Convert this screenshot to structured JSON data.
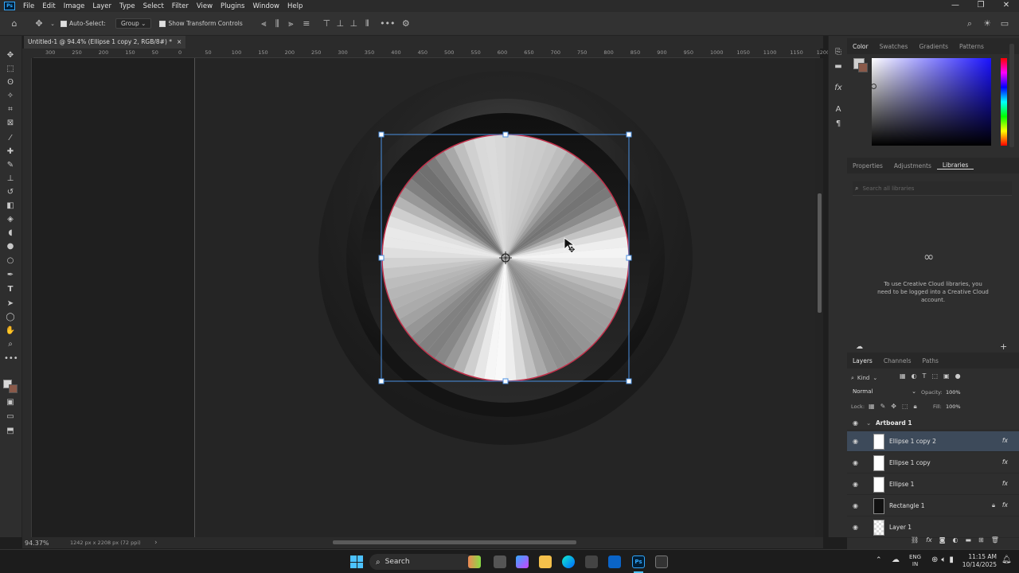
{
  "app": {
    "menus": [
      "File",
      "Edit",
      "Image",
      "Layer",
      "Type",
      "Select",
      "Filter",
      "View",
      "Plugins",
      "Window",
      "Help"
    ],
    "window_controls": [
      "—",
      "❐",
      "✕"
    ]
  },
  "options": {
    "auto_select_label": "Auto-Select:",
    "auto_select_value": "Group",
    "transform_label": "Show Transform Controls"
  },
  "document": {
    "tab_title": "Untitled-1 @ 94.4% (Ellipse 1 copy 2, RGB/8#) *",
    "close": "×"
  },
  "ruler": {
    "labels": [
      "300",
      "250",
      "200",
      "150",
      "50",
      "0",
      "50",
      "100",
      "150",
      "200",
      "250",
      "300",
      "350",
      "400",
      "450",
      "500",
      "550",
      "600",
      "650",
      "700",
      "750",
      "800",
      "850",
      "900",
      "950",
      "1000",
      "1050",
      "1100",
      "1150",
      "1200"
    ]
  },
  "status": {
    "zoom": "94.37%",
    "size": "1242 px x 2208 px (72 ppi)",
    "arrow": "›"
  },
  "color_panel": {
    "tabs": [
      "Color",
      "Swatches",
      "Gradients",
      "Patterns"
    ],
    "active": "Color"
  },
  "libraries_panel": {
    "tabs": [
      "Properties",
      "Adjustments",
      "Libraries"
    ],
    "active": "Libraries",
    "search_placeholder": "Search all libraries",
    "message": "To use Creative Cloud libraries, you need to be logged into a Creative Cloud account."
  },
  "layers_panel": {
    "tabs": [
      "Layers",
      "Channels",
      "Paths"
    ],
    "kind": "Kind",
    "blend_mode": "Normal",
    "opacity_label": "Opacity:",
    "opacity": "100%",
    "lock_label": "Lock:",
    "fill_label": "Fill:",
    "fill": "100%",
    "group": "Artboard 1",
    "layers": [
      {
        "name": "Ellipse 1 copy 2",
        "fx": "fx",
        "selected": true
      },
      {
        "name": "Ellipse 1 copy",
        "fx": "fx"
      },
      {
        "name": "Ellipse 1",
        "fx": "fx"
      },
      {
        "name": "Rectangle 1",
        "fx": "fx"
      },
      {
        "name": "Layer 1",
        "fx": ""
      }
    ]
  },
  "taskbar": {
    "search_label": "Search",
    "lang_top": "ENG",
    "lang_bottom": "IN",
    "time": "11:15 AM",
    "date": "10/14/2025"
  },
  "colors": {
    "selection": "#4a90e2",
    "ellipse_stroke": "#c0304a",
    "ps_blue": "#31a8ff"
  }
}
